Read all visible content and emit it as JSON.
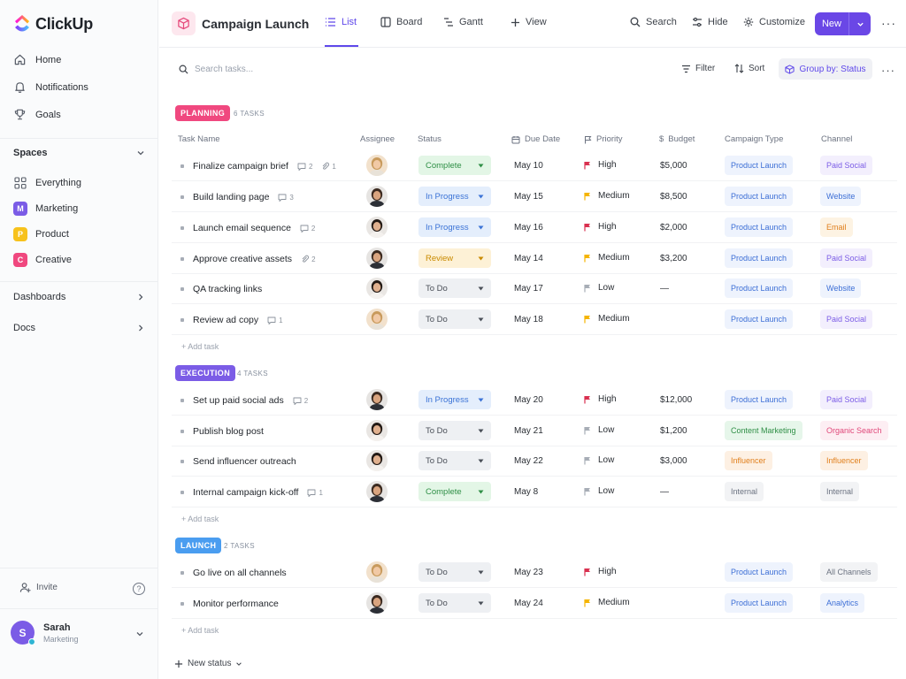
{
  "app": {
    "name": "ClickUp"
  },
  "sidebar": {
    "nav": [
      {
        "label": "Home",
        "icon": "home-icon"
      },
      {
        "label": "Notifications",
        "icon": "bell-icon"
      },
      {
        "label": "Goals",
        "icon": "trophy-icon"
      }
    ],
    "spaces_label": "Spaces",
    "spaces": [
      {
        "label": "Everything",
        "badge": "",
        "color": ""
      },
      {
        "label": "Marketing",
        "badge": "M",
        "color": "#7b5ce6"
      },
      {
        "label": "Product",
        "badge": "P",
        "color": "#f7c21c"
      },
      {
        "label": "Creative",
        "badge": "C",
        "color": "#f0487f"
      }
    ],
    "dashboards_label": "Dashboards",
    "docs_label": "Docs",
    "invite_label": "Invite",
    "help": "?",
    "user": {
      "initial": "S",
      "name": "Sarah",
      "role": "Marketing"
    }
  },
  "header": {
    "title": "Campaign Launch",
    "tabs": [
      {
        "label": "List"
      },
      {
        "label": "Board"
      },
      {
        "label": "Gantt"
      }
    ],
    "add_view": "View",
    "search": "Search",
    "hide": "Hide",
    "customize": "Customize",
    "new": "New"
  },
  "toolbar": {
    "search_placeholder": "Search tasks...",
    "filter": "Filter",
    "sort": "Sort",
    "group_by": "Group by: Status"
  },
  "columns": [
    "Task Name",
    "Assignee",
    "Status",
    "Due Date",
    "Priority",
    "Budget",
    "Campaign Type",
    "Channel"
  ],
  "colors": {
    "accent": "#5f48ea",
    "planning": "#f0487f",
    "execution": "#7b5ce6",
    "launch": "#4a9df0",
    "high": "#d9304f",
    "medium": "#f5b400",
    "low": "#a7adb6"
  },
  "groups": [
    {
      "label": "PLANNING",
      "count": "6 TASKS",
      "add": "+ Add task"
    },
    {
      "label": "EXECUTION",
      "count": "4 TASKS",
      "add": "+ Add task"
    },
    {
      "label": "LAUNCH",
      "count": "2 TASKS",
      "add": "+ Add task"
    }
  ],
  "tasks": [
    {
      "name": "Finalize campaign brief",
      "comments": "2",
      "attachments": "1",
      "status": "Complete",
      "due": "May 10",
      "priority": "High",
      "budget": "$5,000",
      "ctype": "Product Launch",
      "channel": "Paid Social"
    },
    {
      "name": "Build landing page",
      "comments": "3",
      "status": "In Progress",
      "due": "May 15",
      "priority": "Medium",
      "budget": "$8,500",
      "ctype": "Product Launch",
      "channel": "Website"
    },
    {
      "name": "Launch email sequence",
      "comments": "2",
      "status": "In Progress",
      "due": "May 16",
      "priority": "High",
      "budget": "$2,000",
      "ctype": "Product Launch",
      "channel": "Email"
    },
    {
      "name": "Approve creative assets",
      "attachments": "2",
      "status": "Review",
      "due": "May 14",
      "priority": "Medium",
      "budget": "$3,200",
      "ctype": "Product Launch",
      "channel": "Paid Social"
    },
    {
      "name": "QA tracking links",
      "status": "To Do",
      "due": "May 17",
      "priority": "Low",
      "budget": "—",
      "ctype": "Product Launch",
      "channel": "Website"
    },
    {
      "name": "Review ad copy",
      "comments": "1",
      "status": "To Do",
      "due": "May 18",
      "priority": "Medium",
      "budget": "",
      "ctype": "Product Launch",
      "channel": "Paid Social"
    },
    {
      "name": "Set up paid social ads",
      "comments": "2",
      "status": "In Progress",
      "due": "May 20",
      "priority": "High",
      "budget": "$12,000",
      "ctype": "Product Launch",
      "channel": "Paid Social"
    },
    {
      "name": "Publish blog post",
      "status": "To Do",
      "due": "May 21",
      "priority": "Low",
      "budget": "$1,200",
      "ctype": "Content Marketing",
      "channel": "Organic Search"
    },
    {
      "name": "Send influencer outreach",
      "status": "To Do",
      "due": "May 22",
      "priority": "Low",
      "budget": "$3,000",
      "ctype": "Influencer",
      "channel": "Influencer"
    },
    {
      "name": "Internal campaign kick-off",
      "comments": "1",
      "status": "Complete",
      "due": "May 8",
      "priority": "Low",
      "budget": "—",
      "ctype": "Internal",
      "channel": "Internal"
    },
    {
      "name": "Go live on all channels",
      "status": "To Do",
      "due": "May 23",
      "priority": "High",
      "budget": "",
      "ctype": "Product Launch",
      "channel": "All Channels"
    },
    {
      "name": "Monitor performance",
      "status": "To Do",
      "due": "May 24",
      "priority": "Medium",
      "budget": "",
      "ctype": "Product Launch",
      "channel": "Analytics"
    }
  ],
  "new_status": "New status"
}
